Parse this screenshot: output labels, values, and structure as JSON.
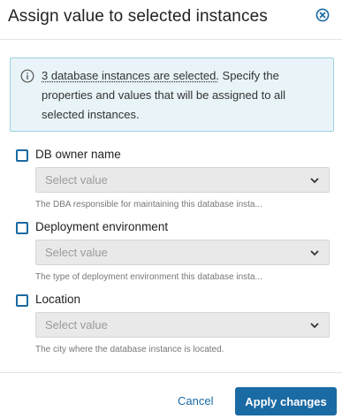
{
  "dialog": {
    "title": "Assign value to selected instances",
    "close_icon": "close-circle-icon"
  },
  "info": {
    "icon": "info-circle-icon",
    "link_text": "3 database instances are selected.",
    "text": " Specify the properties and values that will be assigned to all selected instances."
  },
  "fields": [
    {
      "label": "DB owner name",
      "placeholder": "Select value",
      "help": "The DBA responsible for maintaining this database insta..."
    },
    {
      "label": "Deployment environment",
      "placeholder": "Select value",
      "help": "The type of deployment environment this database insta..."
    },
    {
      "label": "Location",
      "placeholder": "Select value",
      "help": "The city where the database instance is located."
    }
  ],
  "footer": {
    "cancel_label": "Cancel",
    "apply_label": "Apply changes"
  },
  "colors": {
    "accent": "#1a6aa3",
    "info_bg": "#e8f4f8",
    "info_border": "#9fd1e1",
    "disabled_select": "#e9e9e9"
  }
}
